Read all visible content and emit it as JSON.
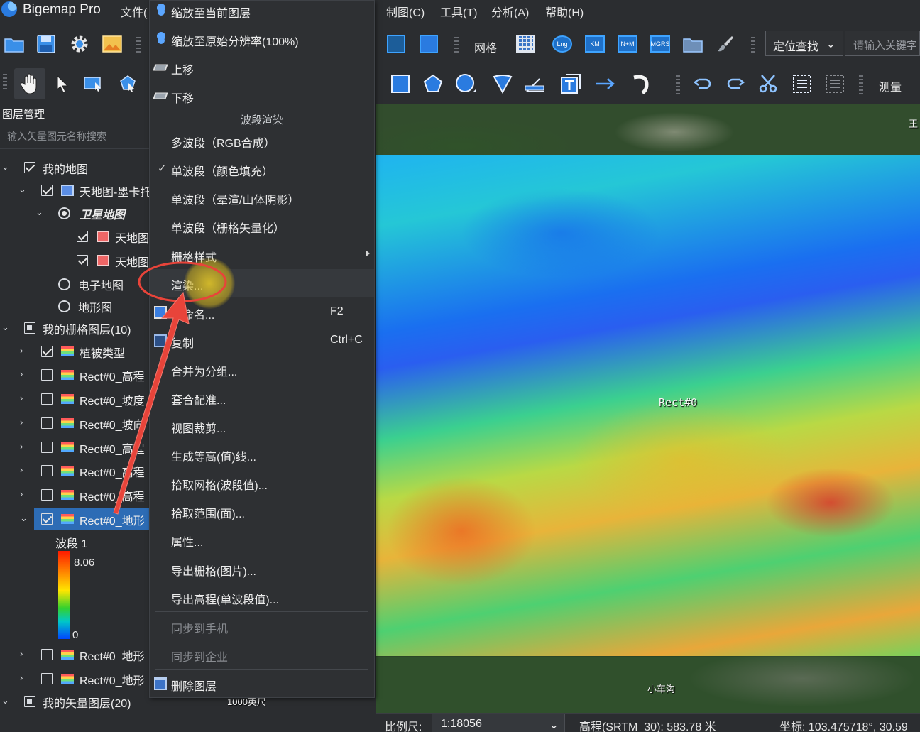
{
  "app": {
    "title": "Bigemap Pro"
  },
  "menus": {
    "file": "文件(",
    "chart": "制图(C)",
    "tools": "工具(T)",
    "analysis": "分析(A)",
    "help": "帮助(H)"
  },
  "toolbar": {
    "grid_label": "网格",
    "lng_icon_text": "Lng",
    "km_icon_text": "KM",
    "nm_icon_text": "N+M",
    "mgrs_icon_text": "MGRS",
    "locate_label": "定位查找",
    "search_placeholder": "请输入关键字",
    "measure_label": "测量"
  },
  "panel": {
    "title": "图层管理",
    "search_placeholder": "输入矢量图元名称搜索",
    "tree": [
      {
        "label": "我的地图"
      },
      {
        "label": "天地图-墨卡托"
      },
      {
        "label": "卫星地图"
      },
      {
        "label": "天地图"
      },
      {
        "label": "天地图"
      },
      {
        "label": "电子地图"
      },
      {
        "label": "地形图"
      },
      {
        "label": "我的栅格图层(10)"
      },
      {
        "label": "植被类型"
      },
      {
        "label": "Rect#0_高程"
      },
      {
        "label": "Rect#0_坡度"
      },
      {
        "label": "Rect#0_坡向"
      },
      {
        "label": "Rect#0_高程"
      },
      {
        "label": "Rect#0_高程"
      },
      {
        "label": "Rect#0_高程"
      },
      {
        "label": "Rect#0_地形"
      },
      {
        "label": "Rect#0_地形"
      },
      {
        "label": "Rect#0_地形"
      },
      {
        "label": "我的矢量图层(20)"
      }
    ],
    "band": {
      "label": "波段 1",
      "max": "8.06",
      "min": "0"
    }
  },
  "context_menu": {
    "items_top": [
      {
        "label": "缩放至当前图层"
      },
      {
        "label": "缩放至原始分辨率(100%)"
      },
      {
        "label": "上移"
      },
      {
        "label": "下移"
      }
    ],
    "band_render_header": "波段渲染",
    "band_items": [
      {
        "label": "多波段（RGB合成）"
      },
      {
        "label": "单波段（颜色填充）",
        "checked": true
      },
      {
        "label": "单波段（晕渲/山体阴影）"
      },
      {
        "label": "单波段（栅格矢量化）"
      }
    ],
    "raster_style": "栅格样式",
    "render": "渲染...",
    "rename": {
      "label": "重命名...",
      "shortcut": "F2"
    },
    "copy": {
      "label": "复制",
      "shortcut": "Ctrl+C"
    },
    "items_mid": [
      {
        "label": "合并为分组..."
      },
      {
        "label": "套合配准..."
      },
      {
        "label": "视图裁剪..."
      },
      {
        "label": "生成等高(值)线..."
      },
      {
        "label": "拾取网格(波段值)..."
      },
      {
        "label": "拾取范围(面)..."
      },
      {
        "label": "属性..."
      }
    ],
    "export_items": [
      {
        "label": "导出栅格(图片)..."
      },
      {
        "label": "导出高程(单波段值)..."
      }
    ],
    "disabled_items": [
      {
        "label": "同步到手机"
      },
      {
        "label": "同步到企业"
      }
    ],
    "delete": "删除图层"
  },
  "map": {
    "raster_label": "Rect#0",
    "place_top_right": "王",
    "place_bottom": "小车沟",
    "scale_fragment": "1000英尺"
  },
  "statusbar": {
    "scale_label": "比例尺:",
    "scale_value": "1:18056",
    "elevation": "高程(SRTM_30): 583.78 米",
    "coord": "坐标: 103.475718°, 30.59"
  },
  "colors": {
    "accent": "#2d6cb5",
    "annotation": "#e8443a",
    "background": "#2b2d30"
  }
}
